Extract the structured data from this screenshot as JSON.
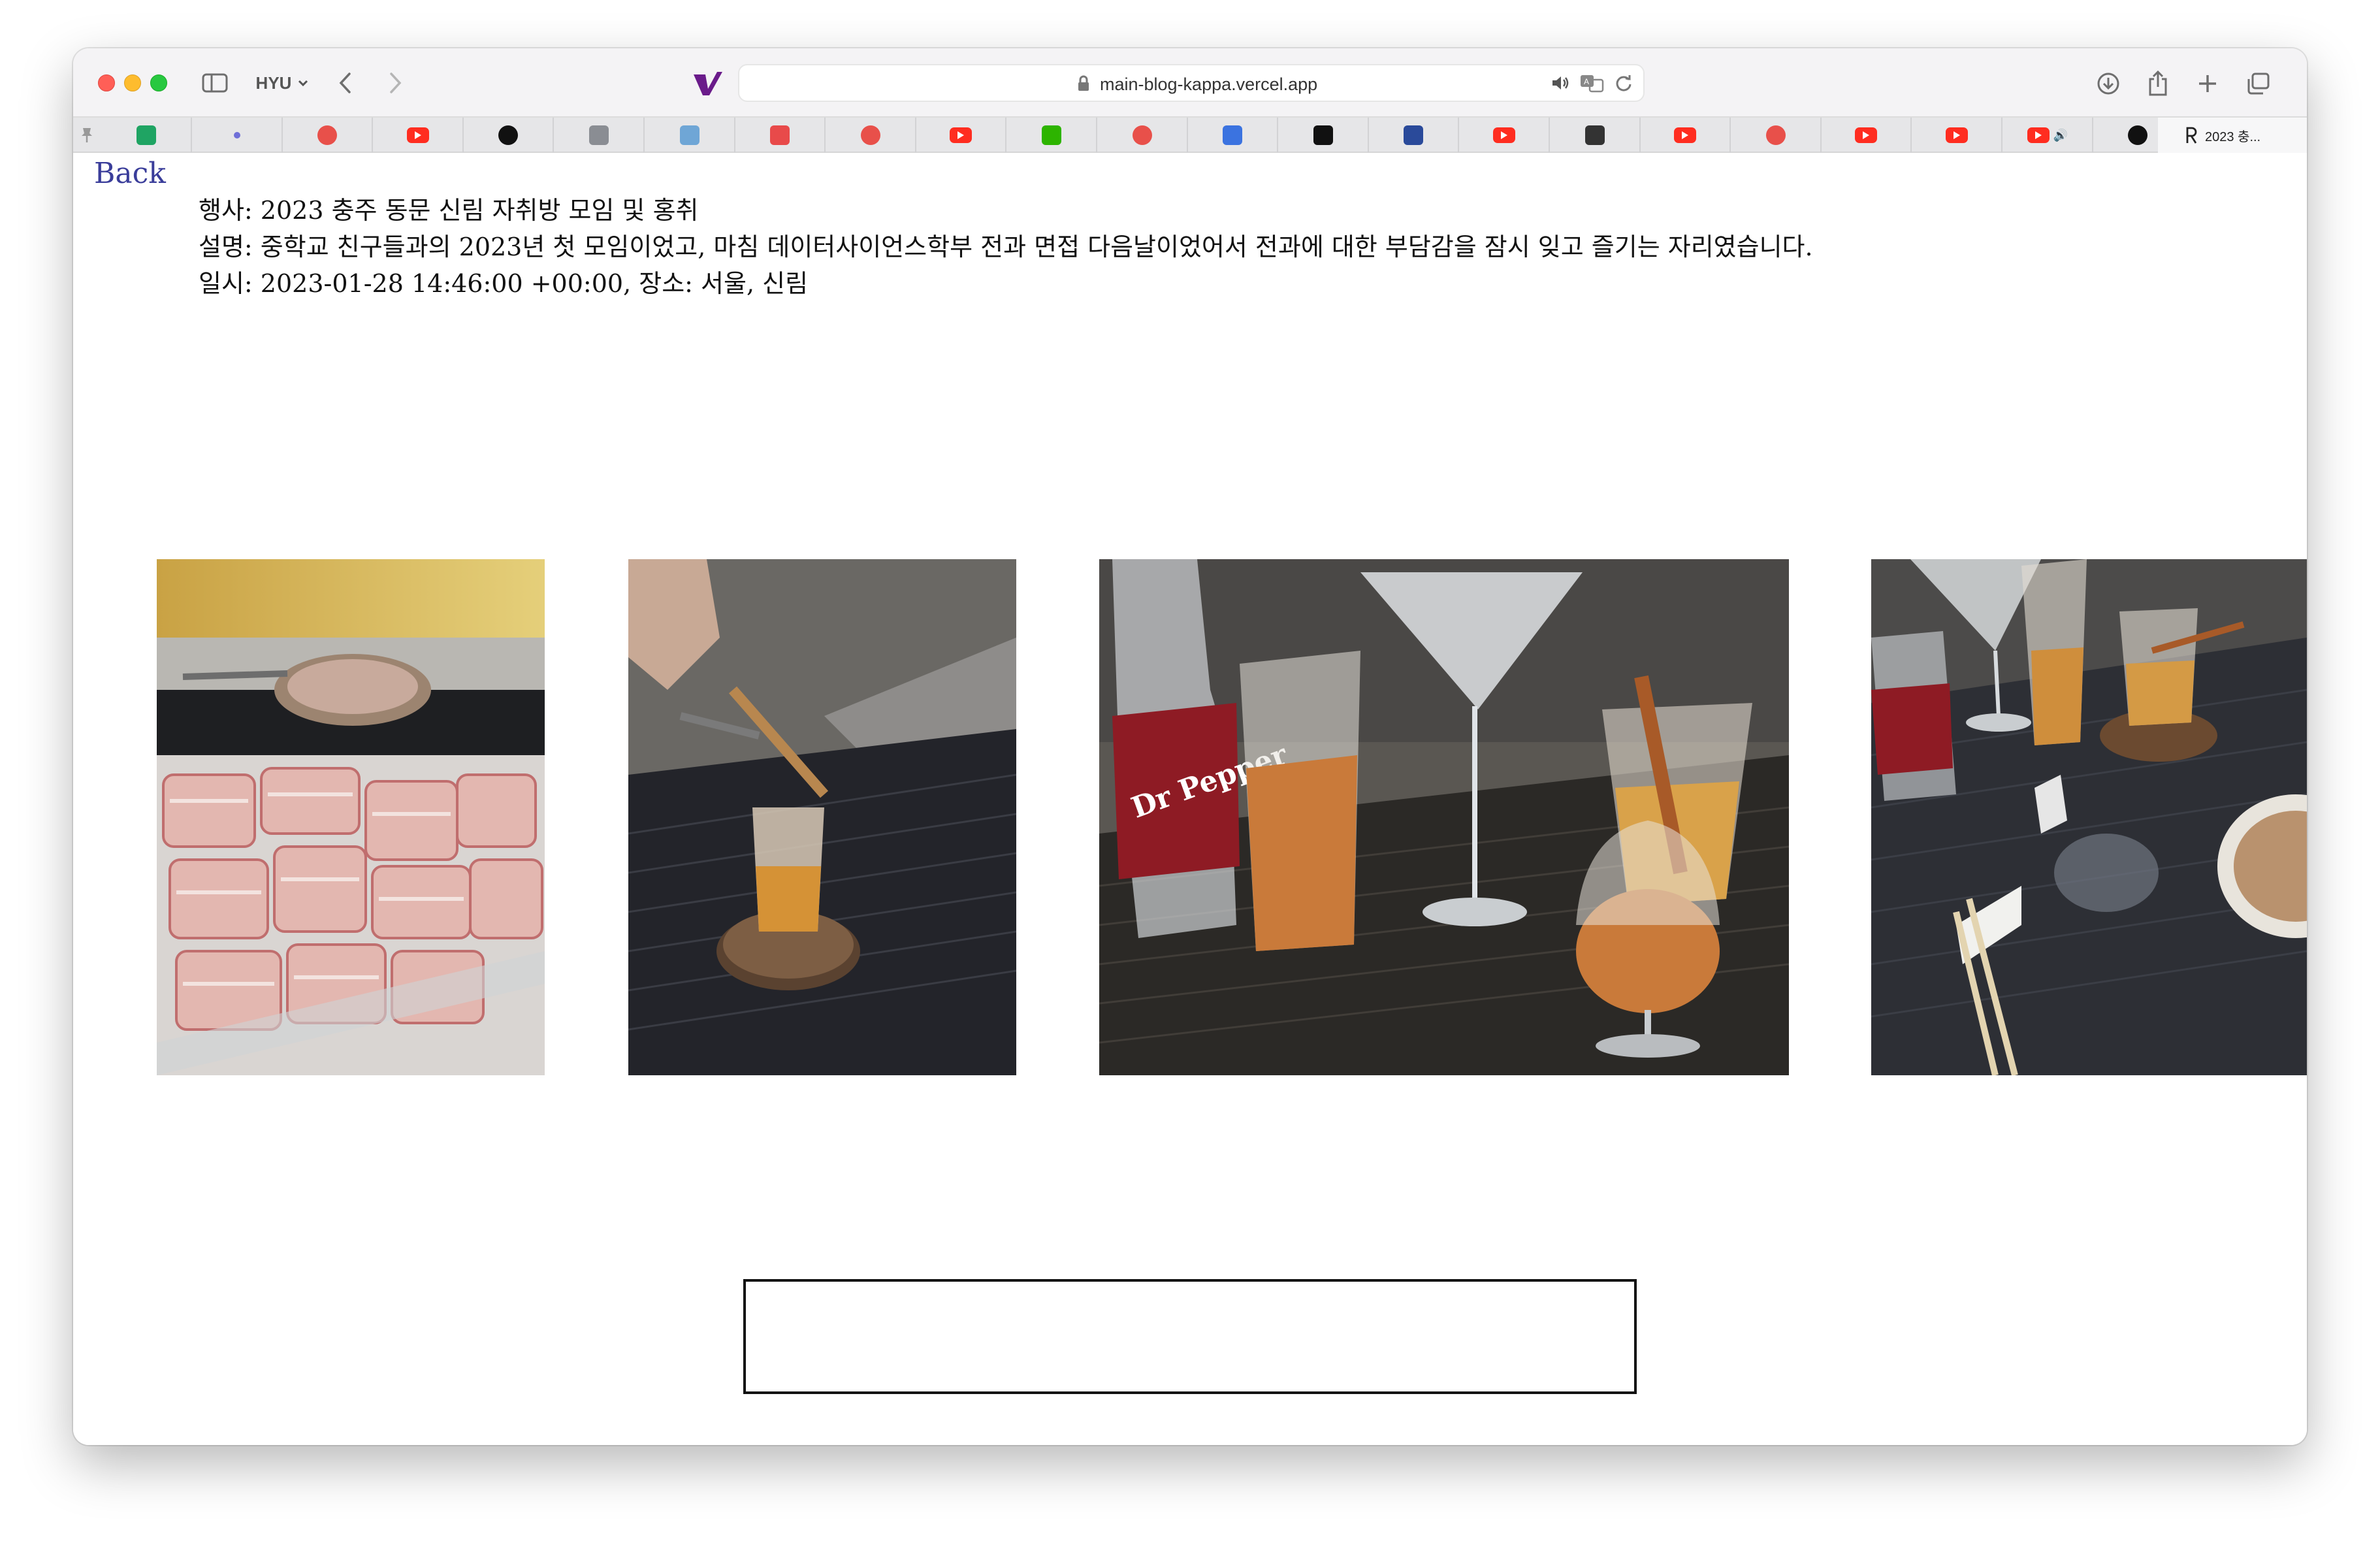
{
  "browser": {
    "profile_label": "HYU",
    "url": "main-blog-kappa.vercel.app",
    "active_tab_title": "2023 충...",
    "tabs": [
      {
        "icon": "sheets-icon",
        "color": "#1fa463"
      },
      {
        "icon": "dot-icon",
        "color": "#6f6fd8"
      },
      {
        "icon": "daum-icon",
        "color": "#e8504a"
      },
      {
        "icon": "youtube-icon",
        "color": "#ff2d20"
      },
      {
        "icon": "swirl-icon",
        "color": "#111111"
      },
      {
        "icon": "g-icon",
        "color": "#8a8d93"
      },
      {
        "icon": "kiki-icon",
        "color": "#6fa6d6"
      },
      {
        "icon": "grid-icon",
        "color": "#e84a4a"
      },
      {
        "icon": "daum-icon",
        "color": "#e8504a"
      },
      {
        "icon": "youtube-icon",
        "color": "#ff2d20"
      },
      {
        "icon": "naver-icon",
        "color": "#2db400"
      },
      {
        "icon": "daum-icon",
        "color": "#e8504a"
      },
      {
        "icon": "bookmark-icon",
        "color": "#3b73e0"
      },
      {
        "icon": "notion-icon",
        "color": "#111111"
      },
      {
        "icon": "layout-icon",
        "color": "#2a4a9a"
      },
      {
        "icon": "youtube-icon",
        "color": "#ff2d20"
      },
      {
        "icon": "figure-icon",
        "color": "#333333"
      },
      {
        "icon": "youtube-icon",
        "color": "#ff2d20"
      },
      {
        "icon": "daum-icon",
        "color": "#e8504a"
      },
      {
        "icon": "youtube-icon",
        "color": "#ff2d20"
      },
      {
        "icon": "youtube-icon",
        "color": "#ff2d20"
      },
      {
        "icon": "youtube-icon",
        "color": "#ff2d20"
      },
      {
        "icon": "triangle-icon",
        "color": "#111111"
      }
    ]
  },
  "page": {
    "back_label": "Back",
    "event_line": "행사: 2023 충주 동문 신림 자취방 모임 및 홍취",
    "description_line": "설명: 중학교 친구들과의 2023년 첫 모임이었고, 마침 데이터사이언스학부 전과 면접 다음날이었어서 전과에 대한 부담감을 잠시 잊고 즐기는 자리였습니다.",
    "datetime_line": "일시: 2023-01-28 14:46:00 +00:00, 장소: 서울, 신림",
    "photos": [
      {
        "subject": "pork-belly-photo"
      },
      {
        "subject": "whisky-glass-photo"
      },
      {
        "subject": "drinks-table-photo"
      },
      {
        "subject": "table-overview-photo"
      }
    ],
    "product_label": "Dr Pepper"
  },
  "colors": {
    "link": "#3a3d9a",
    "accent_logo": "#6a1b8a"
  }
}
